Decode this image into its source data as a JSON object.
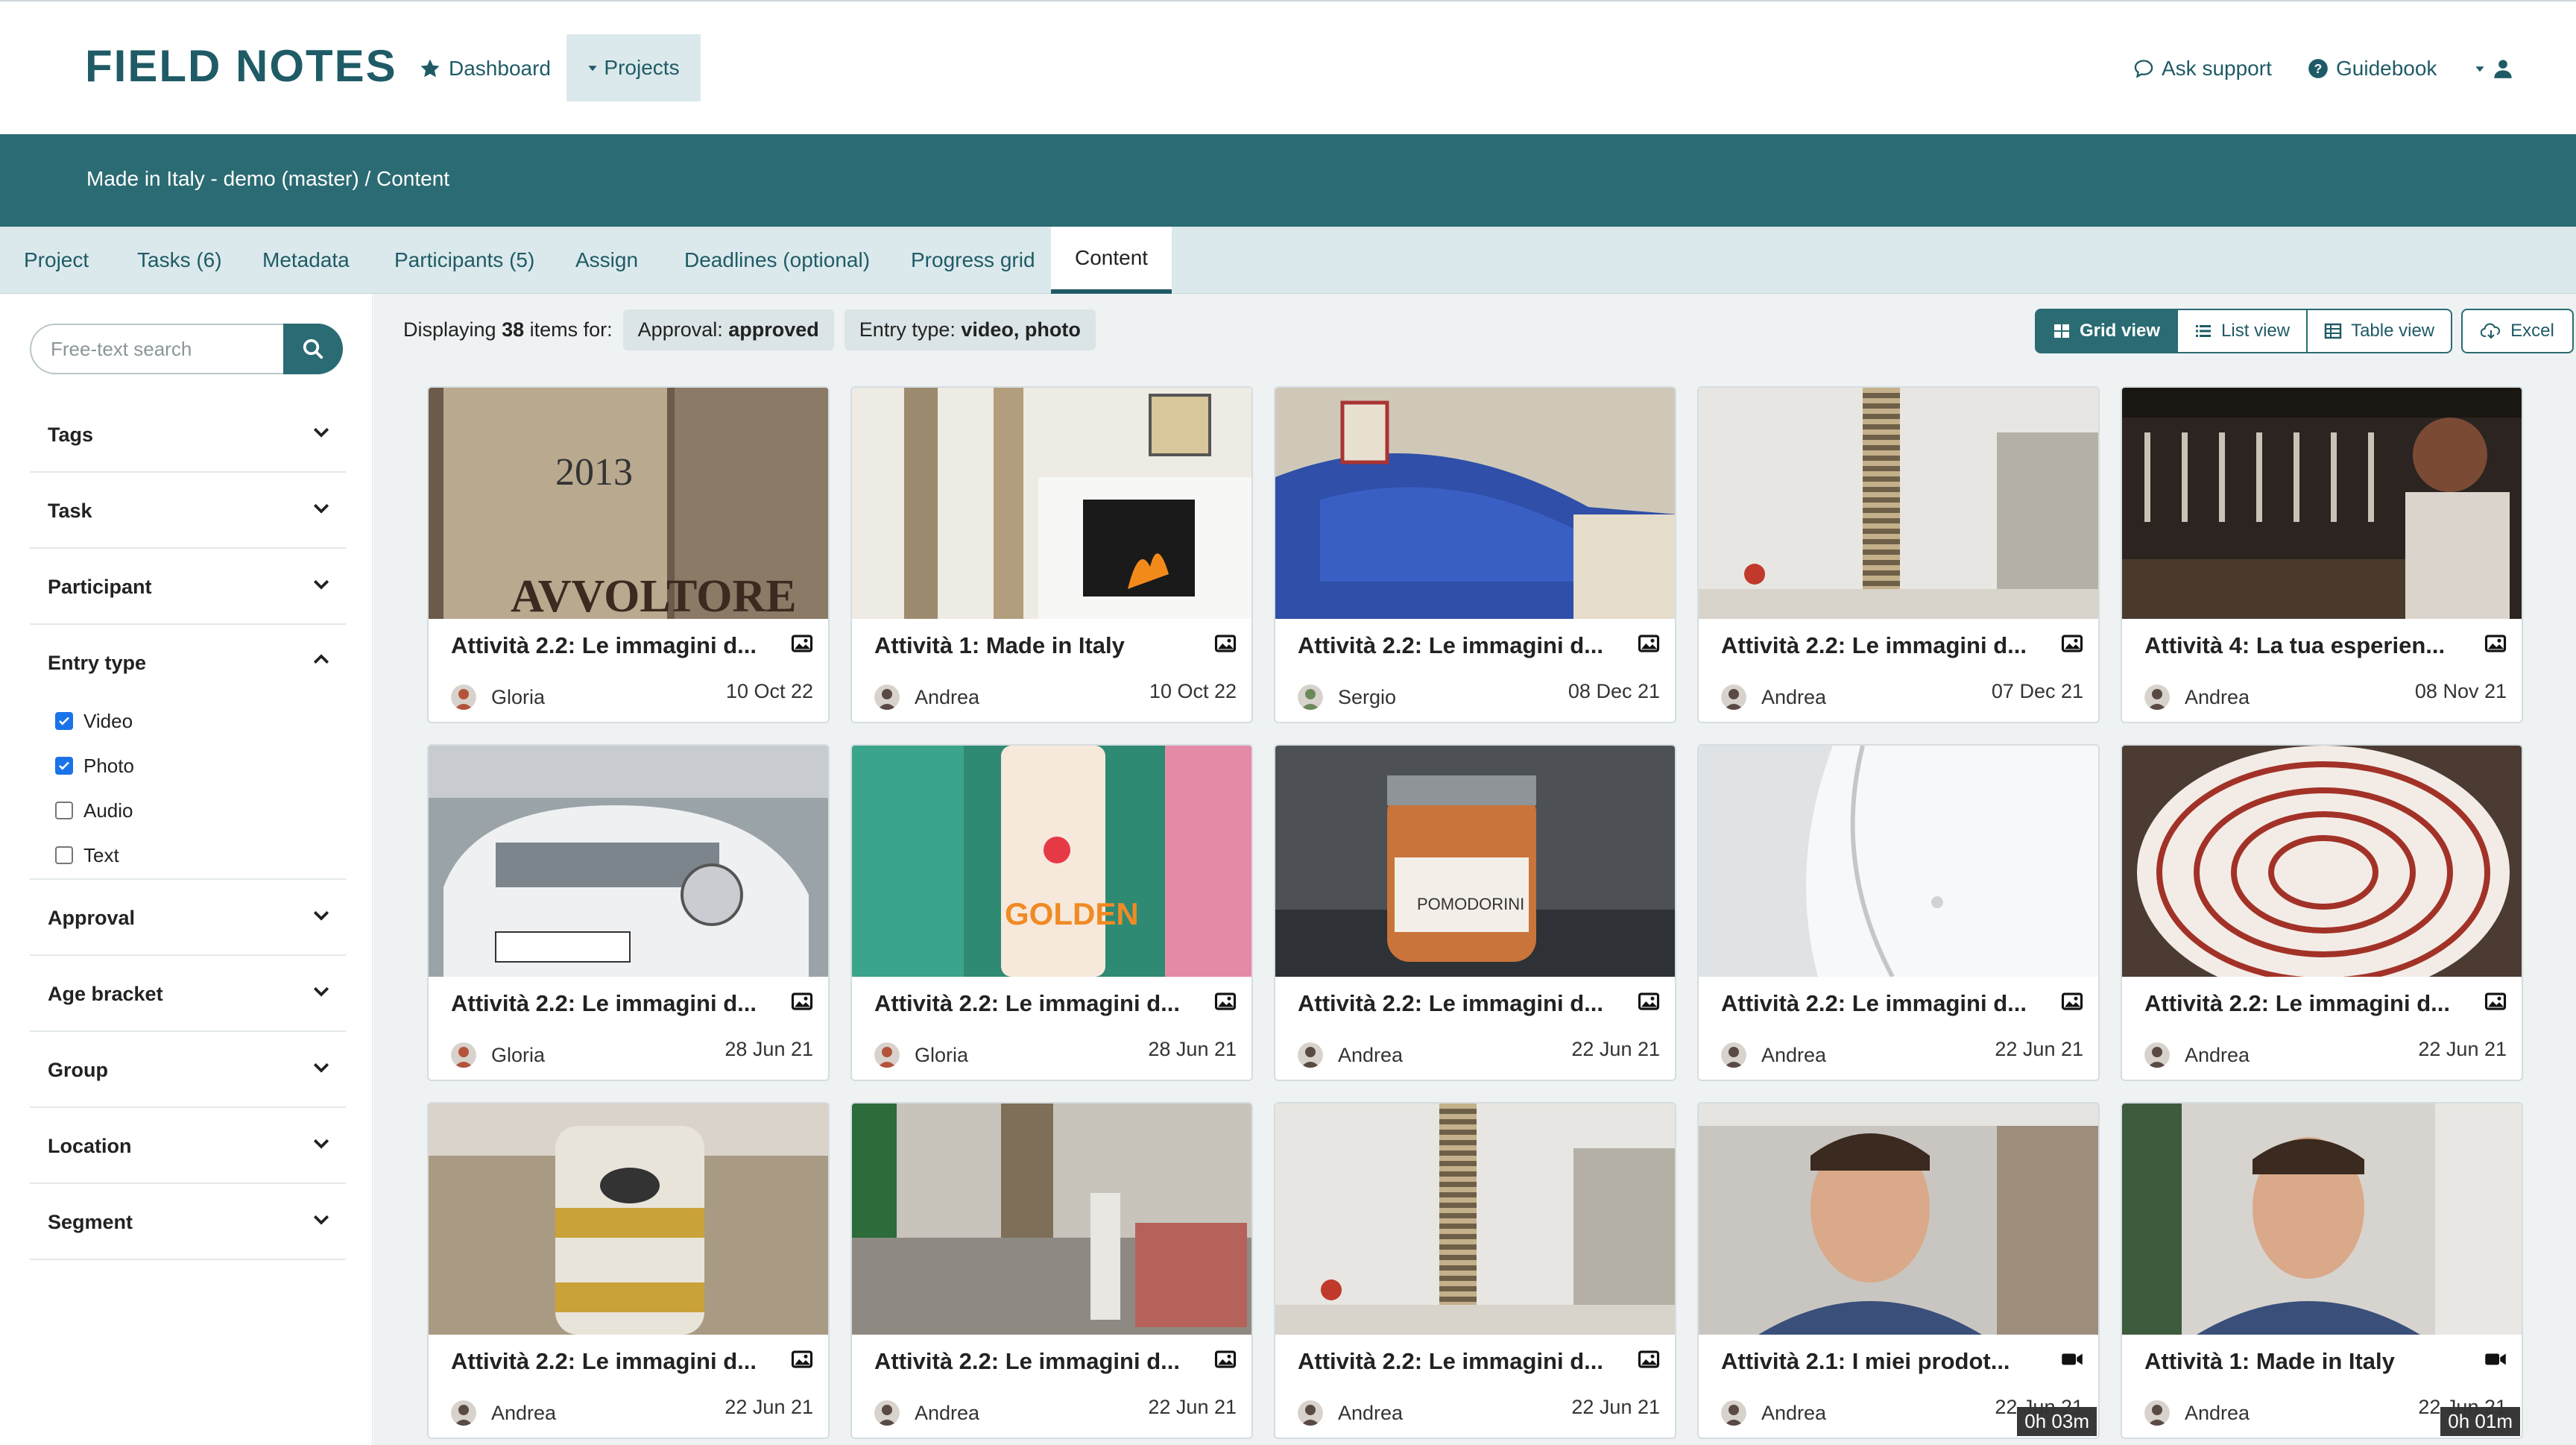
{
  "app": {
    "logo": "FIELD NOTES",
    "nav": {
      "dashboard": "Dashboard",
      "projects": "Projects"
    },
    "nav_right": {
      "support": "Ask support",
      "guidebook": "Guidebook"
    }
  },
  "breadcrumb": "Made in Italy - demo (master) / Content",
  "tabs": [
    {
      "label": "Project"
    },
    {
      "label": "Tasks (6)"
    },
    {
      "label": "Metadata"
    },
    {
      "label": "Participants (5)"
    },
    {
      "label": "Assign"
    },
    {
      "label": "Deadlines (optional)"
    },
    {
      "label": "Progress grid"
    },
    {
      "label": "Content",
      "active": true
    }
  ],
  "sidebar": {
    "search_placeholder": "Free-text search",
    "filters": [
      {
        "label": "Tags",
        "expanded": false
      },
      {
        "label": "Task",
        "expanded": false
      },
      {
        "label": "Participant",
        "expanded": false
      },
      {
        "label": "Entry type",
        "expanded": true
      },
      {
        "label": "Approval",
        "expanded": false
      },
      {
        "label": "Age bracket",
        "expanded": false
      },
      {
        "label": "Group",
        "expanded": false
      },
      {
        "label": "Location",
        "expanded": false
      },
      {
        "label": "Segment",
        "expanded": false
      }
    ],
    "entry_types": [
      {
        "label": "Video",
        "checked": true
      },
      {
        "label": "Photo",
        "checked": true
      },
      {
        "label": "Audio",
        "checked": false
      },
      {
        "label": "Text",
        "checked": false
      }
    ]
  },
  "toolbar": {
    "display_prefix": "Displaying",
    "count": "38",
    "display_suffix": "items for:",
    "chips": [
      {
        "key": "Approval:",
        "value": "approved"
      },
      {
        "key": "Entry type:",
        "value": "video, photo"
      }
    ],
    "views": [
      {
        "label": "Grid view",
        "active": true
      },
      {
        "label": "List view",
        "active": false
      },
      {
        "label": "Table view",
        "active": false
      }
    ],
    "excel": "Excel"
  },
  "accent_colors": {
    "brand": "#2b6b73",
    "tab_bg": "#dbe9ec",
    "check": "#1a73e8"
  },
  "cards": [
    {
      "title": "Attività 2.2: Le immagini d...",
      "author": "Gloria",
      "date": "10 Oct 22",
      "type": "photo",
      "scene": "wine"
    },
    {
      "title": "Attività 1: Made in Italy",
      "author": "Andrea",
      "date": "10 Oct 22",
      "type": "photo",
      "scene": "fireplace"
    },
    {
      "title": "Attività 2.2: Le immagini d...",
      "author": "Sergio",
      "date": "08 Dec 21",
      "type": "photo",
      "scene": "sofa"
    },
    {
      "title": "Attività 2.2: Le immagini d...",
      "author": "Andrea",
      "date": "07 Dec 21",
      "type": "photo",
      "scene": "books"
    },
    {
      "title": "Attività 4: La tua esperien...",
      "author": "Andrea",
      "date": "08 Nov 21",
      "type": "photo",
      "scene": "bar"
    },
    {
      "title": "Attività 2.2: Le immagini d...",
      "author": "Gloria",
      "date": "28 Jun 21",
      "type": "photo",
      "scene": "car"
    },
    {
      "title": "Attività 2.2: Le immagini d...",
      "author": "Gloria",
      "date": "28 Jun 21",
      "type": "photo",
      "scene": "bottle"
    },
    {
      "title": "Attività 2.2: Le immagini d...",
      "author": "Andrea",
      "date": "22 Jun 21",
      "type": "photo",
      "scene": "jar"
    },
    {
      "title": "Attività 2.2: Le immagini d...",
      "author": "Andrea",
      "date": "22 Jun 21",
      "type": "photo",
      "scene": "shirt"
    },
    {
      "title": "Attività 2.2: Le immagini d...",
      "author": "Andrea",
      "date": "22 Jun 21",
      "type": "photo",
      "scene": "plate"
    },
    {
      "title": "Attività 2.2: Le immagini d...",
      "author": "Andrea",
      "date": "22 Jun 21",
      "type": "photo",
      "scene": "vase"
    },
    {
      "title": "Attività 2.2: Le immagini d...",
      "author": "Andrea",
      "date": "22 Jun 21",
      "type": "photo",
      "scene": "room"
    },
    {
      "title": "Attività 2.2: Le immagini d...",
      "author": "Andrea",
      "date": "22 Jun 21",
      "type": "photo",
      "scene": "books"
    },
    {
      "title": "Attività 2.1: I miei prodot...",
      "author": "Andrea",
      "date": "22 Jun 21",
      "type": "video",
      "scene": "man",
      "duration": "0h 03m"
    },
    {
      "title": "Attività 1: Made in Italy",
      "author": "Andrea",
      "date": "22 Jun 21",
      "type": "video",
      "scene": "man2",
      "duration": "0h 01m"
    }
  ]
}
